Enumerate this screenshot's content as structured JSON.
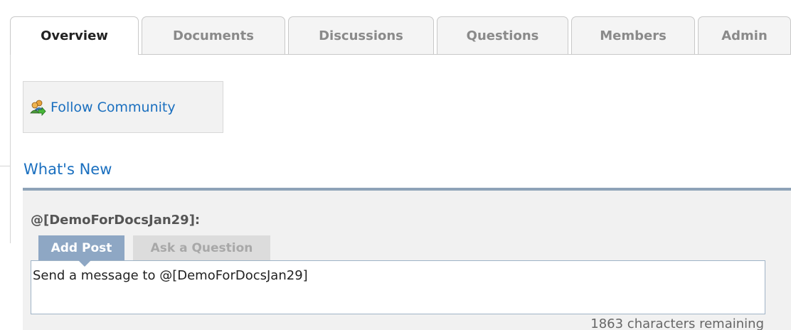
{
  "tabs": [
    {
      "label": "Overview",
      "active": true
    },
    {
      "label": "Documents",
      "active": false
    },
    {
      "label": "Discussions",
      "active": false
    },
    {
      "label": "Questions",
      "active": false
    },
    {
      "label": "Members",
      "active": false
    },
    {
      "label": "Admin",
      "active": false
    }
  ],
  "follow": {
    "label": "Follow Community",
    "icon": "follow-community-icon"
  },
  "whats_new": {
    "heading": "What's New"
  },
  "activity": {
    "target": "@[DemoForDocsJan29]:",
    "post_tabs": {
      "add_post": "Add Post",
      "ask_question": "Ask a Question"
    },
    "message_text": "Send a message to @[DemoForDocsJan29]",
    "chars_remaining": "1863 characters remaining"
  },
  "colors": {
    "link": "#1a6fbf",
    "active_post_tab": "#8ea7c4",
    "panel_border": "#8ea3b8"
  }
}
